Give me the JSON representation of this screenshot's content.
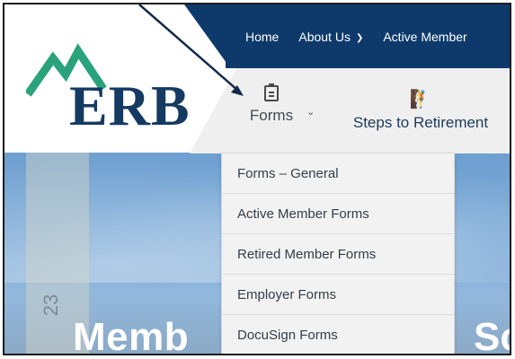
{
  "colors": {
    "navy": "#0e3a6b",
    "logo_green": "#2aa37a",
    "logo_navy": "#153a61",
    "menu_bg": "#f2f2f2"
  },
  "logo": {
    "text": "ERB",
    "icon": "mountain-logo-icon"
  },
  "top_nav": {
    "items": [
      {
        "label": "Home"
      },
      {
        "label": "About Us"
      },
      {
        "label": "Active Member"
      }
    ]
  },
  "main_nav": {
    "forms": {
      "label": "Forms",
      "icon": "clipboard-icon"
    },
    "steps": {
      "label": "Steps to Retirement",
      "icon": "climbing-person-icon"
    }
  },
  "forms_dropdown": {
    "items": [
      {
        "label": "Forms – General"
      },
      {
        "label": "Active Member Forms"
      },
      {
        "label": "Retired Member Forms"
      },
      {
        "label": "Employer Forms"
      },
      {
        "label": "DocuSign Forms"
      }
    ]
  },
  "hero": {
    "title_left": "Memb",
    "title_right": "Sc",
    "side_text": "23"
  }
}
